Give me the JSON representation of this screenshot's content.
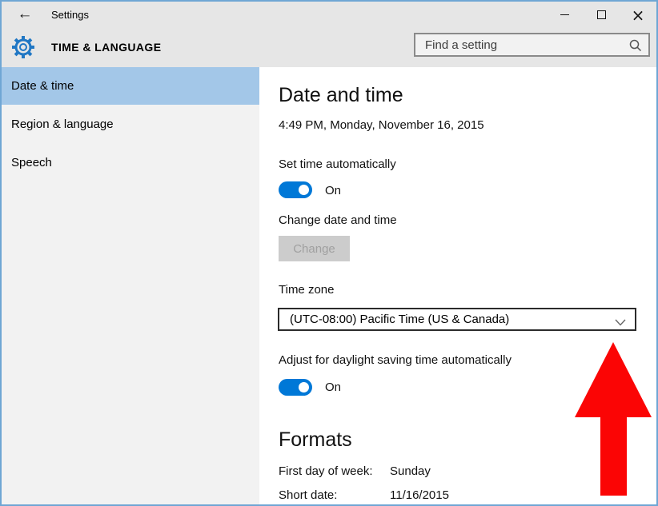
{
  "window": {
    "title": "Settings"
  },
  "icons": {
    "back": "←",
    "close": "×"
  },
  "header": {
    "page_title": "TIME & LANGUAGE",
    "search": {
      "placeholder": "Find a setting"
    }
  },
  "sidebar": {
    "items": [
      {
        "label": "Date & time",
        "selected": true
      },
      {
        "label": "Region & language",
        "selected": false
      },
      {
        "label": "Speech",
        "selected": false
      }
    ]
  },
  "main": {
    "heading": "Date and time",
    "current_datetime": "4:49 PM, Monday, November 16, 2015",
    "set_time": {
      "label": "Set time automatically",
      "state": "On"
    },
    "change_date": {
      "label": "Change date and time",
      "button_label": "Change",
      "button_enabled": false
    },
    "time_zone": {
      "label": "Time zone",
      "selected_option": "(UTC-08:00) Pacific Time (US & Canada)"
    },
    "dst": {
      "label": "Adjust for daylight saving time automatically",
      "state": "On"
    },
    "formats": {
      "heading": "Formats",
      "rows": [
        {
          "label": "First day of week:",
          "value": "Sunday"
        },
        {
          "label": "Short date:",
          "value": "11/16/2015"
        }
      ]
    }
  },
  "annotation": {
    "shape": "red-arrow-up",
    "color": "#fb0505",
    "points_at": "time-zone-dropdown"
  },
  "colors": {
    "accent": "#0078d7",
    "sidebar_selected": "#a3c7e8",
    "header_bg": "#e6e6e6",
    "sidebar_bg": "#f2f2f2",
    "disabled_button_bg": "#cccccc",
    "disabled_button_text": "#a0a0a0",
    "window_border": "#6fa6d4"
  }
}
